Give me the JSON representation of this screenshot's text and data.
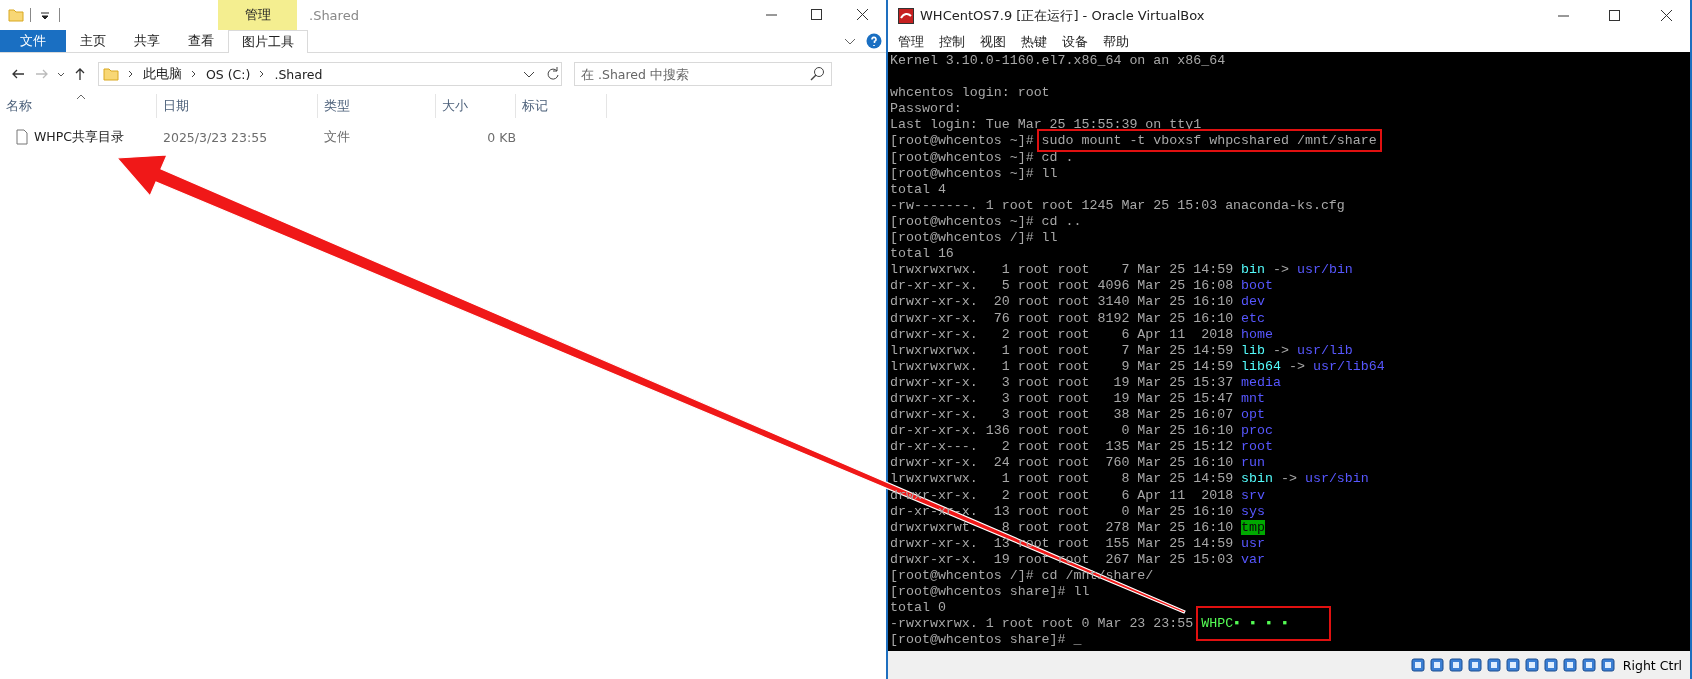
{
  "explorer": {
    "context_tab": "管理",
    "title": ".Shared",
    "ribbon_tabs": [
      {
        "label": "文件",
        "kind": "file",
        "selected": false
      },
      {
        "label": "主页",
        "kind": "tab",
        "selected": false
      },
      {
        "label": "共享",
        "kind": "tab",
        "selected": false
      },
      {
        "label": "查看",
        "kind": "tab",
        "selected": false
      },
      {
        "label": "图片工具",
        "kind": "contextual",
        "selected": true
      }
    ],
    "address": [
      "此电脑",
      "OS (C:)",
      ".Shared"
    ],
    "search": {
      "placeholder": "在 .Shared 中搜索"
    },
    "columns": [
      "名称",
      "日期",
      "类型",
      "大小",
      "标记"
    ],
    "files": [
      {
        "name": "WHPC共享目录",
        "date": "2025/3/23 23:55",
        "type": "文件",
        "size": "0 KB"
      }
    ]
  },
  "vm": {
    "title": "WHCentOS7.9 [正在运行] - Oracle VirtualBox",
    "menu": [
      "管理",
      "控制",
      "视图",
      "热键",
      "设备",
      "帮助"
    ],
    "terminal": [
      {
        "segments": [
          {
            "text": "Kernel 3.10.0-1160.el7.x86_64 on an x86_64",
            "kind": "plain"
          }
        ]
      },
      {
        "blank_before": true,
        "segments": [
          {
            "text": "whcentos login: root",
            "kind": "plain"
          }
        ]
      },
      {
        "segments": [
          {
            "text": "Password:",
            "kind": "plain"
          }
        ]
      },
      {
        "segments": [
          {
            "text": "Last login: Tue Mar 25 15:55:39 on tty1",
            "kind": "plain"
          }
        ]
      },
      {
        "segments": [
          {
            "text": "[root@whcentos ~]# ",
            "kind": "plain"
          },
          {
            "text": "sudo mount -t vboxsf whpcshared /mnt/share",
            "kind": "plain",
            "highlighted": true
          }
        ]
      },
      {
        "segments": [
          {
            "text": "[root@whcentos ~]# cd .",
            "kind": "plain"
          }
        ]
      },
      {
        "segments": [
          {
            "text": "[root@whcentos ~]# ll",
            "kind": "plain"
          }
        ]
      },
      {
        "segments": [
          {
            "text": "total 4",
            "kind": "plain"
          }
        ]
      },
      {
        "segments": [
          {
            "text": "-rw-------. 1 root root 1245 Mar 25 15:03 anaconda-ks.cfg",
            "kind": "plain"
          }
        ]
      },
      {
        "segments": [
          {
            "text": "[root@whcentos ~]# cd ..",
            "kind": "plain"
          }
        ]
      },
      {
        "segments": [
          {
            "text": "[root@whcentos /]# ll",
            "kind": "plain"
          }
        ]
      },
      {
        "segments": [
          {
            "text": "total 16",
            "kind": "plain"
          }
        ]
      },
      {
        "segments": [
          {
            "text": "lrwxrwxrwx.   1 root root    7 Mar 25 14:59 ",
            "kind": "plain"
          },
          {
            "text": "bin",
            "kind": "link"
          },
          {
            "text": " -> ",
            "kind": "plain"
          },
          {
            "text": "usr/bin",
            "kind": "dir"
          }
        ]
      },
      {
        "segments": [
          {
            "text": "dr-xr-xr-x.   5 root root 4096 Mar 25 16:08 ",
            "kind": "plain"
          },
          {
            "text": "boot",
            "kind": "dir"
          }
        ]
      },
      {
        "segments": [
          {
            "text": "drwxr-xr-x.  20 root root 3140 Mar 25 16:10 ",
            "kind": "plain"
          },
          {
            "text": "dev",
            "kind": "dir"
          }
        ]
      },
      {
        "segments": [
          {
            "text": "drwxr-xr-x.  76 root root 8192 Mar 25 16:10 ",
            "kind": "plain"
          },
          {
            "text": "etc",
            "kind": "dir"
          }
        ]
      },
      {
        "segments": [
          {
            "text": "drwxr-xr-x.   2 root root    6 Apr 11  2018 ",
            "kind": "plain"
          },
          {
            "text": "home",
            "kind": "dir"
          }
        ]
      },
      {
        "segments": [
          {
            "text": "lrwxrwxrwx.   1 root root    7 Mar 25 14:59 ",
            "kind": "plain"
          },
          {
            "text": "lib",
            "kind": "link"
          },
          {
            "text": " -> ",
            "kind": "plain"
          },
          {
            "text": "usr/lib",
            "kind": "dir"
          }
        ]
      },
      {
        "segments": [
          {
            "text": "lrwxrwxrwx.   1 root root    9 Mar 25 14:59 ",
            "kind": "plain"
          },
          {
            "text": "lib64",
            "kind": "link"
          },
          {
            "text": " -> ",
            "kind": "plain"
          },
          {
            "text": "usr/lib64",
            "kind": "dir"
          }
        ]
      },
      {
        "segments": [
          {
            "text": "drwxr-xr-x.   3 root root   19 Mar 25 15:37 ",
            "kind": "plain"
          },
          {
            "text": "media",
            "kind": "dir"
          }
        ]
      },
      {
        "segments": [
          {
            "text": "drwxr-xr-x.   3 root root   19 Mar 25 15:47 ",
            "kind": "plain"
          },
          {
            "text": "mnt",
            "kind": "dir"
          }
        ]
      },
      {
        "segments": [
          {
            "text": "drwxr-xr-x.   3 root root   38 Mar 25 16:07 ",
            "kind": "plain"
          },
          {
            "text": "opt",
            "kind": "dir"
          }
        ]
      },
      {
        "segments": [
          {
            "text": "dr-xr-xr-x. 136 root root    0 Mar 25 16:10 ",
            "kind": "plain"
          },
          {
            "text": "proc",
            "kind": "dir"
          }
        ]
      },
      {
        "segments": [
          {
            "text": "dr-xr-x---.   2 root root  135 Mar 25 15:12 ",
            "kind": "plain"
          },
          {
            "text": "root",
            "kind": "dir"
          }
        ]
      },
      {
        "segments": [
          {
            "text": "drwxr-xr-x.  24 root root  760 Mar 25 16:10 ",
            "kind": "plain"
          },
          {
            "text": "run",
            "kind": "dir"
          }
        ]
      },
      {
        "segments": [
          {
            "text": "lrwxrwxrwx.   1 root root    8 Mar 25 14:59 ",
            "kind": "plain"
          },
          {
            "text": "sbin",
            "kind": "link"
          },
          {
            "text": " -> ",
            "kind": "plain"
          },
          {
            "text": "usr/sbin",
            "kind": "dir"
          }
        ]
      },
      {
        "segments": [
          {
            "text": "drwxr-xr-x.   2 root root    6 Apr 11  2018 ",
            "kind": "plain"
          },
          {
            "text": "srv",
            "kind": "dir"
          }
        ]
      },
      {
        "segments": [
          {
            "text": "dr-xr-xr-x.  13 root root    0 Mar 25 16:10 ",
            "kind": "plain"
          },
          {
            "text": "sys",
            "kind": "dir"
          }
        ]
      },
      {
        "segments": [
          {
            "text": "drwxrwxrwt.   8 root root  278 Mar 25 16:10 ",
            "kind": "plain"
          },
          {
            "text": "tmp",
            "kind": "sticky"
          }
        ]
      },
      {
        "segments": [
          {
            "text": "drwxr-xr-x.  13 root root  155 Mar 25 14:59 ",
            "kind": "plain"
          },
          {
            "text": "usr",
            "kind": "dir"
          }
        ]
      },
      {
        "segments": [
          {
            "text": "drwxr-xr-x.  19 root root  267 Mar 25 15:03 ",
            "kind": "plain"
          },
          {
            "text": "var",
            "kind": "dir"
          }
        ]
      },
      {
        "segments": [
          {
            "text": "[root@whcentos /]# cd /mnt/share/",
            "kind": "plain"
          }
        ]
      },
      {
        "segments": [
          {
            "text": "[root@whcentos share]# ll",
            "kind": "plain"
          }
        ]
      },
      {
        "segments": [
          {
            "text": "total 0",
            "kind": "plain"
          }
        ]
      },
      {
        "segments": [
          {
            "text": "-rwxrwxrwx. 1 root root 0 Mar 23 23:55 ",
            "kind": "plain"
          },
          {
            "text": "WHPC▪ ▪ ▪ ▪",
            "kind": "exec",
            "highlighted": true
          }
        ]
      },
      {
        "segments": [
          {
            "text": "[root@whcentos share]# _",
            "kind": "plain"
          }
        ]
      }
    ],
    "host_key": "Right Ctrl"
  }
}
